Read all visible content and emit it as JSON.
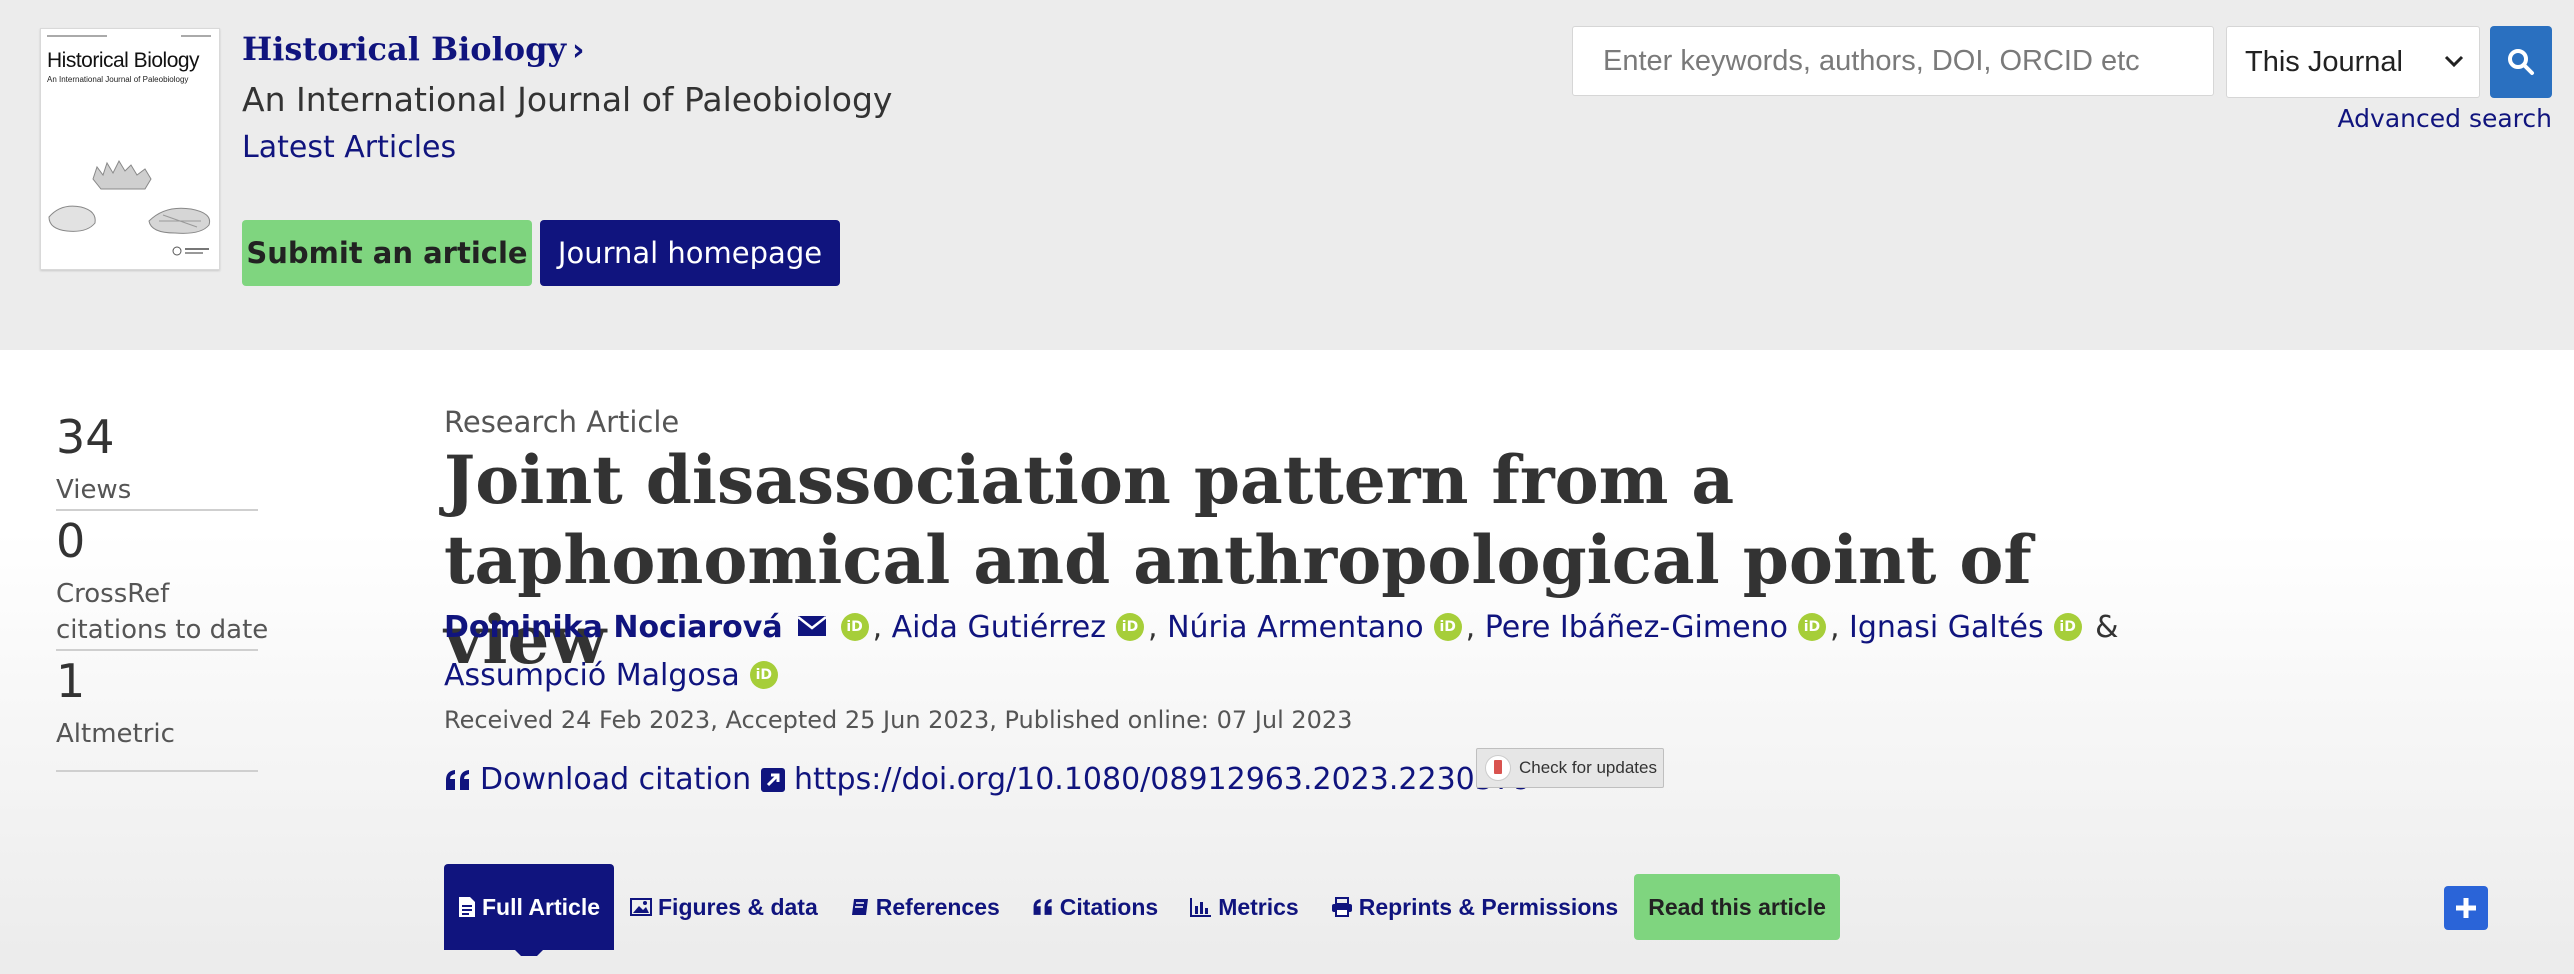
{
  "header": {
    "journal_title": "Historical Biology",
    "journal_subtitle": "An International Journal of Paleobiology",
    "latest_articles": "Latest Articles",
    "submit_label": "Submit an article",
    "homepage_label": "Journal homepage",
    "cover": {
      "title": "Historical Biology",
      "subtitle": "An International Journal of Paleobiology"
    }
  },
  "search": {
    "placeholder": "Enter keywords, authors, DOI, ORCID etc",
    "value": "",
    "scope": "This Journal",
    "advanced": "Advanced search"
  },
  "metrics": [
    {
      "value": "34",
      "label": "Views"
    },
    {
      "value": "0",
      "label_line1": "CrossRef",
      "label_line2": "citations to date"
    },
    {
      "value": "1",
      "label": "Altmetric"
    }
  ],
  "article": {
    "type": "Research Article",
    "title": "Joint disassociation pattern from a taphonomical and anthropological point of view",
    "authors": [
      {
        "name": "Dominika Nociarová"
      },
      {
        "name": "Aida Gutiérrez"
      },
      {
        "name": "Núria Armentano"
      },
      {
        "name": "Pere Ibáñez-Gimeno"
      },
      {
        "name": "Ignasi Galtés"
      },
      {
        "name": "Assumpció Malgosa"
      }
    ],
    "orcid_label": "iD",
    "dates": "Received 24 Feb 2023, Accepted 25 Jun 2023, Published online: 07 Jul 2023",
    "download_citation": "Download citation",
    "doi": "https://doi.org/10.1080/08912963.2023.2230579",
    "check_updates": "Check for updates"
  },
  "tabs": [
    {
      "label": "Full Article",
      "icon": "file-icon"
    },
    {
      "label": "Figures & data",
      "icon": "image-icon"
    },
    {
      "label": "References",
      "icon": "book-icon"
    },
    {
      "label": "Citations",
      "icon": "quote-icon"
    },
    {
      "label": "Metrics",
      "icon": "bar-chart-icon"
    },
    {
      "label": "Reprints & Permissions",
      "icon": "print-icon"
    }
  ],
  "read_article": "Read this article",
  "colors": {
    "brand_navy": "#10147e",
    "green": "#7fd57f",
    "search_blue": "#2a70c0",
    "orcid_green": "#a6ce39"
  }
}
